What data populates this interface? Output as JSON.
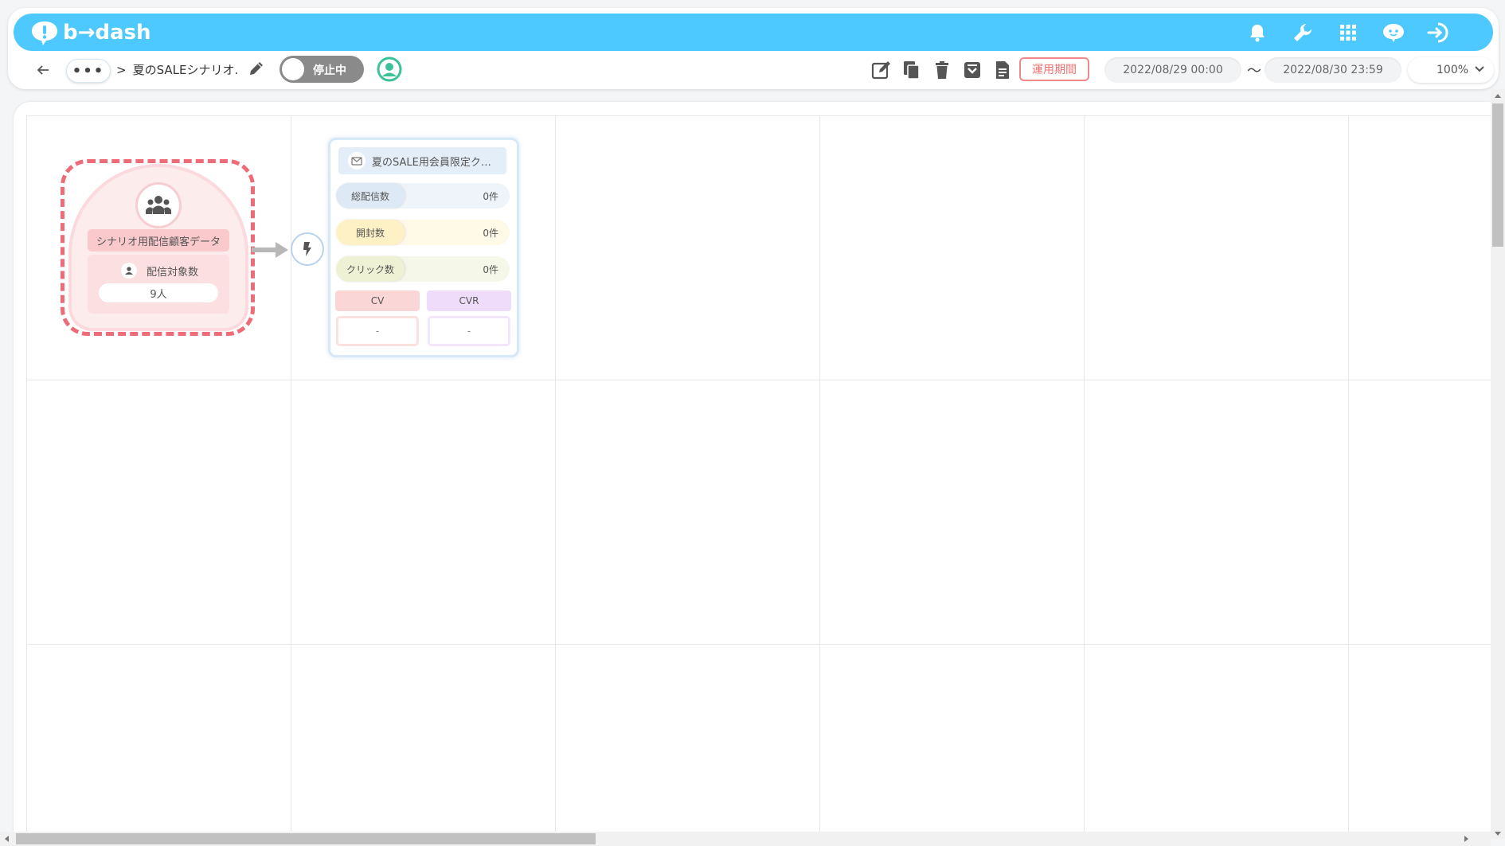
{
  "app": {
    "logo_text": "b→dash",
    "brand_color": "#4dc9ff"
  },
  "header_icons": [
    "bell-icon",
    "wrench-icon",
    "grid-apps-icon",
    "support-chat-icon",
    "logout-icon"
  ],
  "toolbar": {
    "more_label": "•••",
    "crumb_sep": ">",
    "scenario_name": "夏のSALEシナリオ.",
    "status_label": "停止中",
    "period_button": "運用期間",
    "date_from": "2022/08/29 00:00",
    "tilde": "〜",
    "date_to": "2022/08/30 23:59",
    "zoom": "100%"
  },
  "segment_node": {
    "title": "シナリオ用配信顧客データ",
    "count_label": "配信対象数",
    "count_value": "9人"
  },
  "mail_node": {
    "title": "夏のSALE用会員限定ク…",
    "stats": [
      {
        "label": "総配信数",
        "value": "0件"
      },
      {
        "label": "開封数",
        "value": "0件"
      },
      {
        "label": "クリック数",
        "value": "0件"
      }
    ],
    "cv_label": "CV",
    "cvr_label": "CVR",
    "cv_value": "-",
    "cvr_value": "-"
  }
}
